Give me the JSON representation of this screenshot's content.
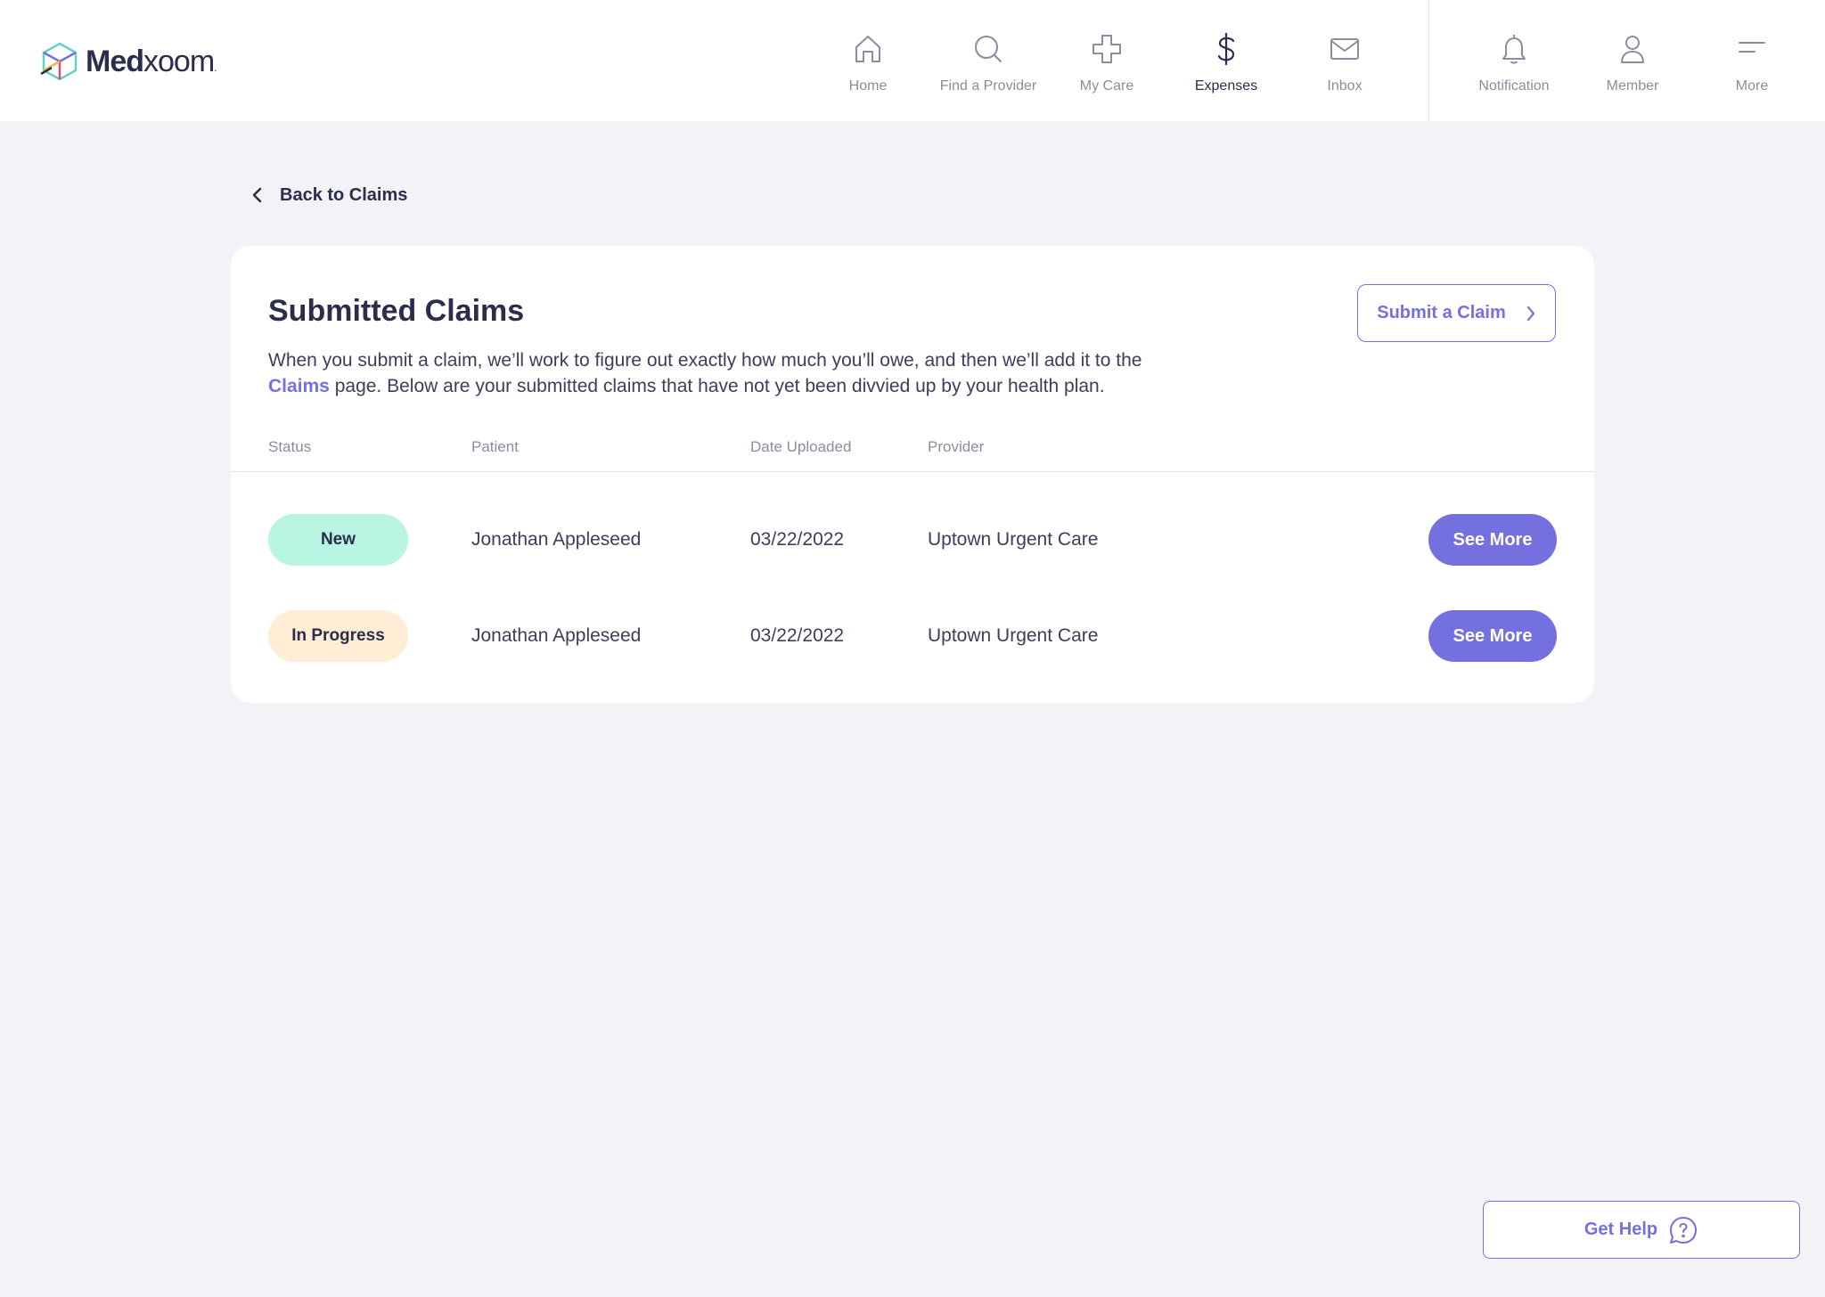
{
  "brand": {
    "name_bold": "Med",
    "name_light": "xoom",
    "reg_mark": "."
  },
  "nav": {
    "items": [
      {
        "label": "Home",
        "icon": "home-icon"
      },
      {
        "label": "Find a Provider",
        "icon": "search-icon"
      },
      {
        "label": "My Care",
        "icon": "plus-cross-icon"
      },
      {
        "label": "Expenses",
        "icon": "dollar-icon",
        "active": true
      },
      {
        "label": "Inbox",
        "icon": "mail-icon"
      }
    ],
    "utility": [
      {
        "label": "Notification",
        "icon": "bell-icon"
      },
      {
        "label": "Member",
        "icon": "user-icon"
      },
      {
        "label": "More",
        "icon": "menu-icon"
      }
    ]
  },
  "back_link": {
    "label": "Back to Claims"
  },
  "card": {
    "title": "Submitted Claims",
    "description_before": "When you submit a claim, we’ll work to figure out exactly how much you’ll owe, and then we’ll add it to the",
    "description_link": "Claims",
    "description_after": "page. Below are your submitted claims that have not yet been divvied up by your health plan.",
    "submit_button": "Submit a Claim"
  },
  "table": {
    "headers": {
      "status": "Status",
      "patient": "Patient",
      "date": "Date Uploaded",
      "provider": "Provider"
    },
    "rows": [
      {
        "status": "New",
        "patient": "Jonathan Appleseed",
        "date": "03/22/2022",
        "provider": "Uptown Urgent Care",
        "action": "See More"
      },
      {
        "status": "In Progress",
        "patient": "Jonathan Appleseed",
        "date": "03/22/2022",
        "provider": "Uptown Urgent Care",
        "action": "See More"
      }
    ]
  },
  "help_button": {
    "label": "Get Help"
  },
  "colors": {
    "accent": "#7470e0",
    "status_new_bg": "#b8f5e2",
    "status_in_progress_bg": "#ffedd6",
    "page_bg": "#f3f3f7",
    "text_dark": "#2b2d4a"
  }
}
